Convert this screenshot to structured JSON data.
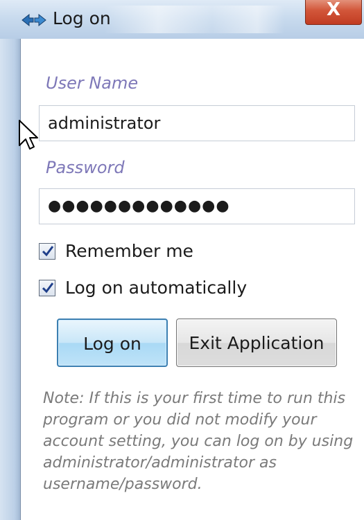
{
  "window": {
    "title": "Log on",
    "close_label": "X"
  },
  "form": {
    "username_label": "User Name",
    "username_value": "administrator",
    "password_label": "Password",
    "password_value": "●●●●●●●●●●●●●",
    "remember_label": "Remember me",
    "remember_checked": true,
    "autologon_label": "Log on automatically",
    "autologon_checked": true
  },
  "buttons": {
    "logon_label": "Log on",
    "exit_label": "Exit Application"
  },
  "note": "Note: If this is your first time to run this program or you did not modify your account setting, you can log on by using administrator/administrator as username/password.",
  "colors": {
    "label": "#7e78b8",
    "note": "#7a7a7a",
    "logon_button": "#bfe3f8"
  },
  "icons": [
    "app-icon",
    "close-icon",
    "checkmark-icon",
    "mouse-cursor-icon"
  ]
}
